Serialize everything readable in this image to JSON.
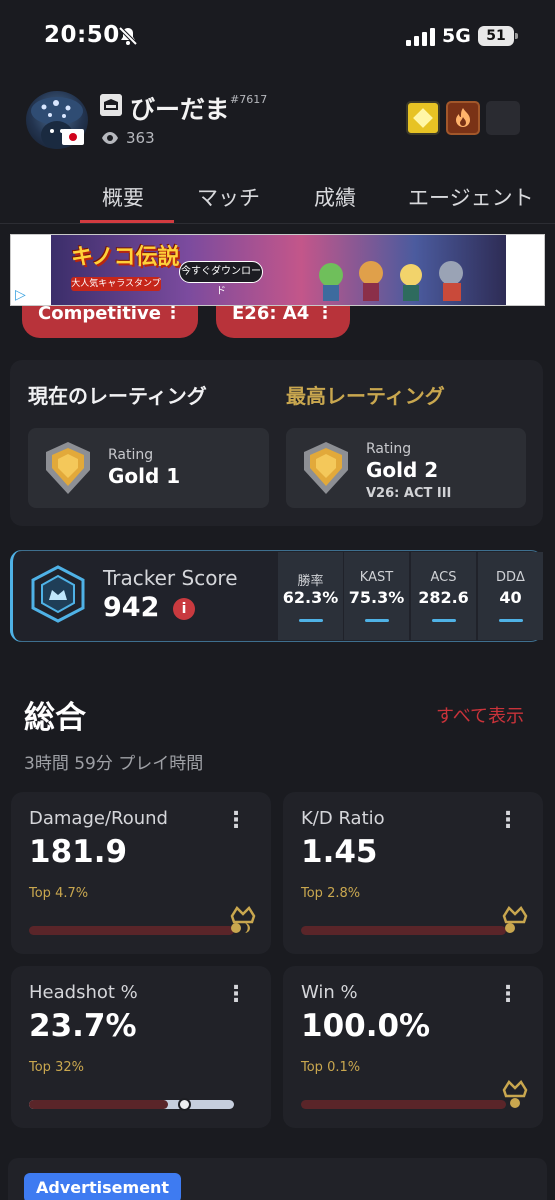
{
  "status_bar": {
    "time": "20:50",
    "network": "5G",
    "battery": "51"
  },
  "profile": {
    "name": "びーだま",
    "tag": "#7617",
    "views": "363"
  },
  "tabs": [
    {
      "label": "概要"
    },
    {
      "label": "マッチ"
    },
    {
      "label": "成績"
    },
    {
      "label": "エージェント"
    }
  ],
  "banner_ad": {
    "title": "キノコ伝説",
    "subtitle": "大人気キャラスタンプ",
    "cta": "今すぐダウンロード"
  },
  "filters": {
    "mode": "Competitive",
    "act": "E26: A4"
  },
  "rating": {
    "current_heading": "現在のレーティング",
    "peak_heading": "最高レーティング",
    "current": {
      "label": "Rating",
      "value": "Gold 1"
    },
    "peak": {
      "label": "Rating",
      "value": "Gold 2",
      "season": "V26: ACT III"
    }
  },
  "tracker_score": {
    "label": "Tracker Score",
    "value": "942",
    "stats": [
      {
        "label": "勝率",
        "value": "62.3%"
      },
      {
        "label": "KAST",
        "value": "75.3%"
      },
      {
        "label": "ACS",
        "value": "282.6"
      },
      {
        "label": "DDΔ",
        "value": "40"
      }
    ]
  },
  "overview": {
    "title": "総合",
    "view_all": "すべて表示",
    "playtime": "3時間 59分 プレイ時間",
    "stats": [
      {
        "name": "Damage/Round",
        "value": "181.9",
        "top": "Top 4.7%",
        "percentile": 95.3
      },
      {
        "name": "K/D Ratio",
        "value": "1.45",
        "top": "Top 2.8%",
        "percentile": 97.2
      },
      {
        "name": "Headshot %",
        "value": "23.7%",
        "top": "Top 32%",
        "percentile": 68
      },
      {
        "name": "Win %",
        "value": "100.0%",
        "top": "Top 0.1%",
        "percentile": 99.9
      }
    ]
  },
  "footer_ad": {
    "label": "Advertisement"
  },
  "colors": {
    "accent_red": "#c9333a",
    "gold": "#c9a74f",
    "tracker_blue": "#4fb2e6",
    "background": "#1a1b20"
  }
}
